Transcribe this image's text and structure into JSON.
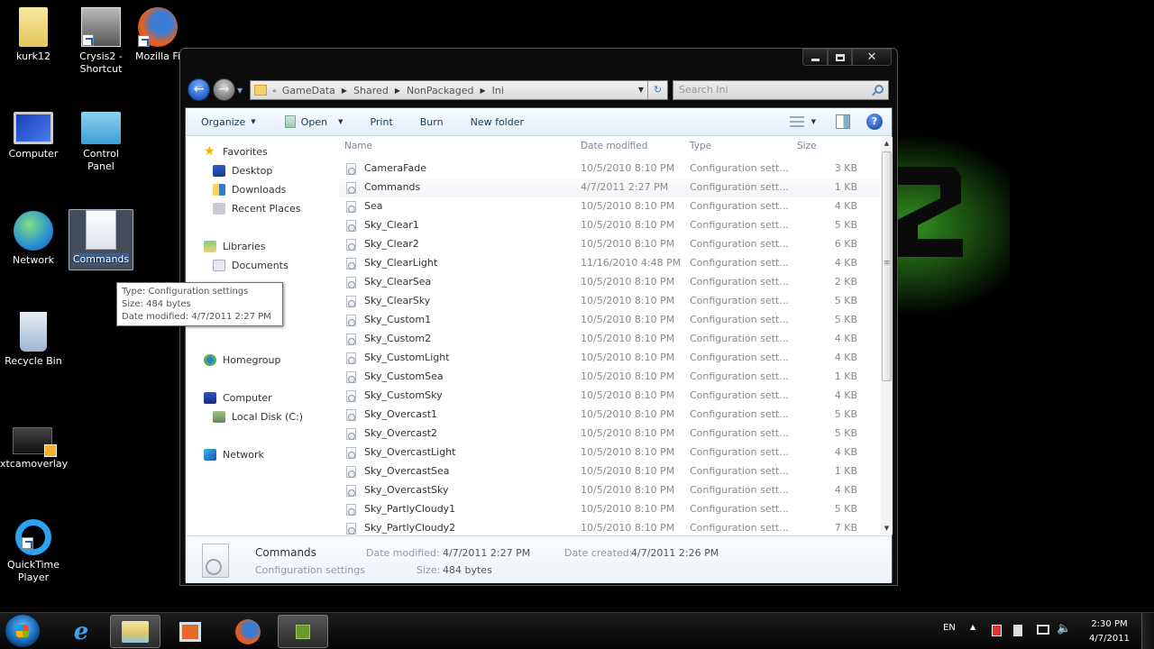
{
  "desktop": {
    "icons": [
      {
        "label": "kurk12",
        "name": "desktop-icon-kurk12"
      },
      {
        "label": "Crysis2 - Shortcut",
        "name": "desktop-icon-crysis2"
      },
      {
        "label": "Mozilla Firefox",
        "name": "desktop-icon-firefox"
      },
      {
        "label": "Computer",
        "name": "desktop-icon-computer"
      },
      {
        "label": "Control Panel",
        "name": "desktop-icon-control-panel"
      },
      {
        "label": "Network",
        "name": "desktop-icon-network"
      },
      {
        "label": "Commands",
        "name": "desktop-icon-commands"
      },
      {
        "label": "Recycle Bin",
        "name": "desktop-icon-recycle-bin"
      },
      {
        "label": "xtcamoverlay",
        "name": "desktop-icon-xtcamoverlay"
      },
      {
        "label": "QuickTime Player",
        "name": "desktop-icon-quicktime"
      }
    ],
    "tooltip": {
      "type": "Type: Configuration settings",
      "size": "Size: 484 bytes",
      "modified": "Date modified: 4/7/2011 2:27 PM"
    },
    "wallpaper_accent": "#3caa28"
  },
  "window": {
    "breadcrumb": [
      "GameData",
      "Shared",
      "NonPackaged",
      "Ini"
    ],
    "search_placeholder": "Search Ini",
    "toolbar": {
      "organize": "Organize",
      "open": "Open",
      "print": "Print",
      "burn": "Burn",
      "new_folder": "New folder",
      "help": "?"
    },
    "nav": {
      "favorites": "Favorites",
      "desktop": "Desktop",
      "downloads": "Downloads",
      "recent": "Recent Places",
      "libraries": "Libraries",
      "documents": "Documents",
      "homegroup": "Homegroup",
      "computer": "Computer",
      "local_disk": "Local Disk (C:)",
      "network": "Network"
    },
    "columns": {
      "name": "Name",
      "date": "Date modified",
      "type": "Type",
      "size": "Size"
    },
    "files": [
      {
        "name": "CameraFade",
        "date": "10/5/2010 8:10 PM",
        "type": "Configuration sett...",
        "size": "3 KB"
      },
      {
        "name": "Commands",
        "date": "4/7/2011 2:27 PM",
        "type": "Configuration sett...",
        "size": "1 KB"
      },
      {
        "name": "Sea",
        "date": "10/5/2010 8:10 PM",
        "type": "Configuration sett...",
        "size": "4 KB"
      },
      {
        "name": "Sky_Clear1",
        "date": "10/5/2010 8:10 PM",
        "type": "Configuration sett...",
        "size": "5 KB"
      },
      {
        "name": "Sky_Clear2",
        "date": "10/5/2010 8:10 PM",
        "type": "Configuration sett...",
        "size": "6 KB"
      },
      {
        "name": "Sky_ClearLight",
        "date": "11/16/2010 4:48 PM",
        "type": "Configuration sett...",
        "size": "4 KB"
      },
      {
        "name": "Sky_ClearSea",
        "date": "10/5/2010 8:10 PM",
        "type": "Configuration sett...",
        "size": "2 KB"
      },
      {
        "name": "Sky_ClearSky",
        "date": "10/5/2010 8:10 PM",
        "type": "Configuration sett...",
        "size": "5 KB"
      },
      {
        "name": "Sky_Custom1",
        "date": "10/5/2010 8:10 PM",
        "type": "Configuration sett...",
        "size": "5 KB"
      },
      {
        "name": "Sky_Custom2",
        "date": "10/5/2010 8:10 PM",
        "type": "Configuration sett...",
        "size": "4 KB"
      },
      {
        "name": "Sky_CustomLight",
        "date": "10/5/2010 8:10 PM",
        "type": "Configuration sett...",
        "size": "4 KB"
      },
      {
        "name": "Sky_CustomSea",
        "date": "10/5/2010 8:10 PM",
        "type": "Configuration sett...",
        "size": "1 KB"
      },
      {
        "name": "Sky_CustomSky",
        "date": "10/5/2010 8:10 PM",
        "type": "Configuration sett...",
        "size": "4 KB"
      },
      {
        "name": "Sky_Overcast1",
        "date": "10/5/2010 8:10 PM",
        "type": "Configuration sett...",
        "size": "5 KB"
      },
      {
        "name": "Sky_Overcast2",
        "date": "10/5/2010 8:10 PM",
        "type": "Configuration sett...",
        "size": "5 KB"
      },
      {
        "name": "Sky_OvercastLight",
        "date": "10/5/2010 8:10 PM",
        "type": "Configuration sett...",
        "size": "4 KB"
      },
      {
        "name": "Sky_OvercastSea",
        "date": "10/5/2010 8:10 PM",
        "type": "Configuration sett...",
        "size": "1 KB"
      },
      {
        "name": "Sky_OvercastSky",
        "date": "10/5/2010 8:10 PM",
        "type": "Configuration sett...",
        "size": "4 KB"
      },
      {
        "name": "Sky_PartlyCloudy1",
        "date": "10/5/2010 8:10 PM",
        "type": "Configuration sett...",
        "size": "5 KB"
      },
      {
        "name": "Sky_PartlyCloudy2",
        "date": "10/5/2010 8:10 PM",
        "type": "Configuration sett...",
        "size": "7 KB"
      }
    ],
    "details": {
      "name": "Commands",
      "kind": "Configuration settings",
      "modified_label": "Date modified:",
      "modified_value": "4/7/2011 2:27 PM",
      "created_label": "Date created:",
      "created_value": "4/7/2011 2:26 PM",
      "size_label": "Size:",
      "size_value": "484 bytes"
    }
  },
  "taskbar": {
    "language": "EN",
    "time": "2:30 PM",
    "date": "4/7/2011",
    "pinned": [
      "Internet Explorer",
      "Windows Explorer",
      "Windows Media Player",
      "Firefox",
      "Crysis 2"
    ]
  }
}
